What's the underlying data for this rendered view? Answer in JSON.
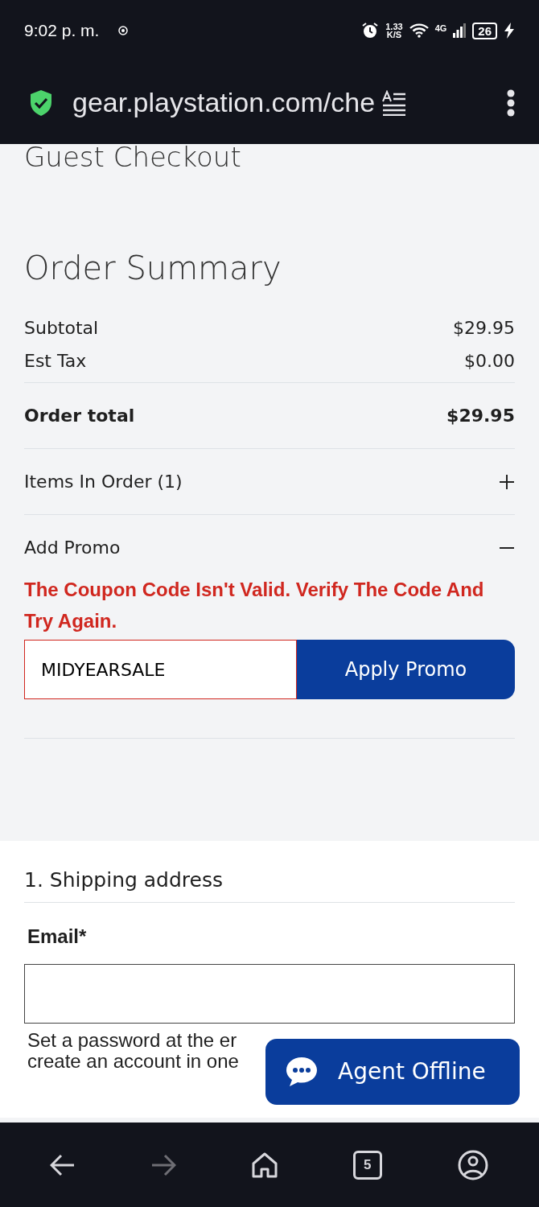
{
  "status_bar": {
    "time": "9:02 p. m.",
    "network_speed": "1.33",
    "speed_unit": "K/S",
    "network_type": "4G",
    "battery": "26"
  },
  "browser": {
    "url": "gear.playstation.com/che",
    "tabs_count": "5",
    "forward_disabled": true
  },
  "page_heading": "Guest Checkout",
  "order_summary": {
    "title": "Order Summary",
    "rows": [
      {
        "kind": "line",
        "label": "Subtotal",
        "value": "$29.95"
      },
      {
        "kind": "line",
        "label": "Est Tax",
        "value": "$0.00"
      },
      {
        "kind": "total",
        "label": "Order total",
        "value": "$29.95"
      }
    ],
    "sections": [
      {
        "label": "Items In Order (1)",
        "expanded": false
      },
      {
        "label": "Add Promo",
        "expanded": true
      }
    ]
  },
  "promo": {
    "error": "The Coupon Code Isn't Valid. Verify The Code And Try Again.",
    "value": "MIDYEARSALE",
    "invalid": true,
    "button": "Apply Promo"
  },
  "shipping": {
    "title": "1. Shipping address",
    "email_label": "Email*",
    "help_lines": [
      "Set a password at the er",
      "create an account in one"
    ]
  },
  "chat_button": "Agent Offline"
}
